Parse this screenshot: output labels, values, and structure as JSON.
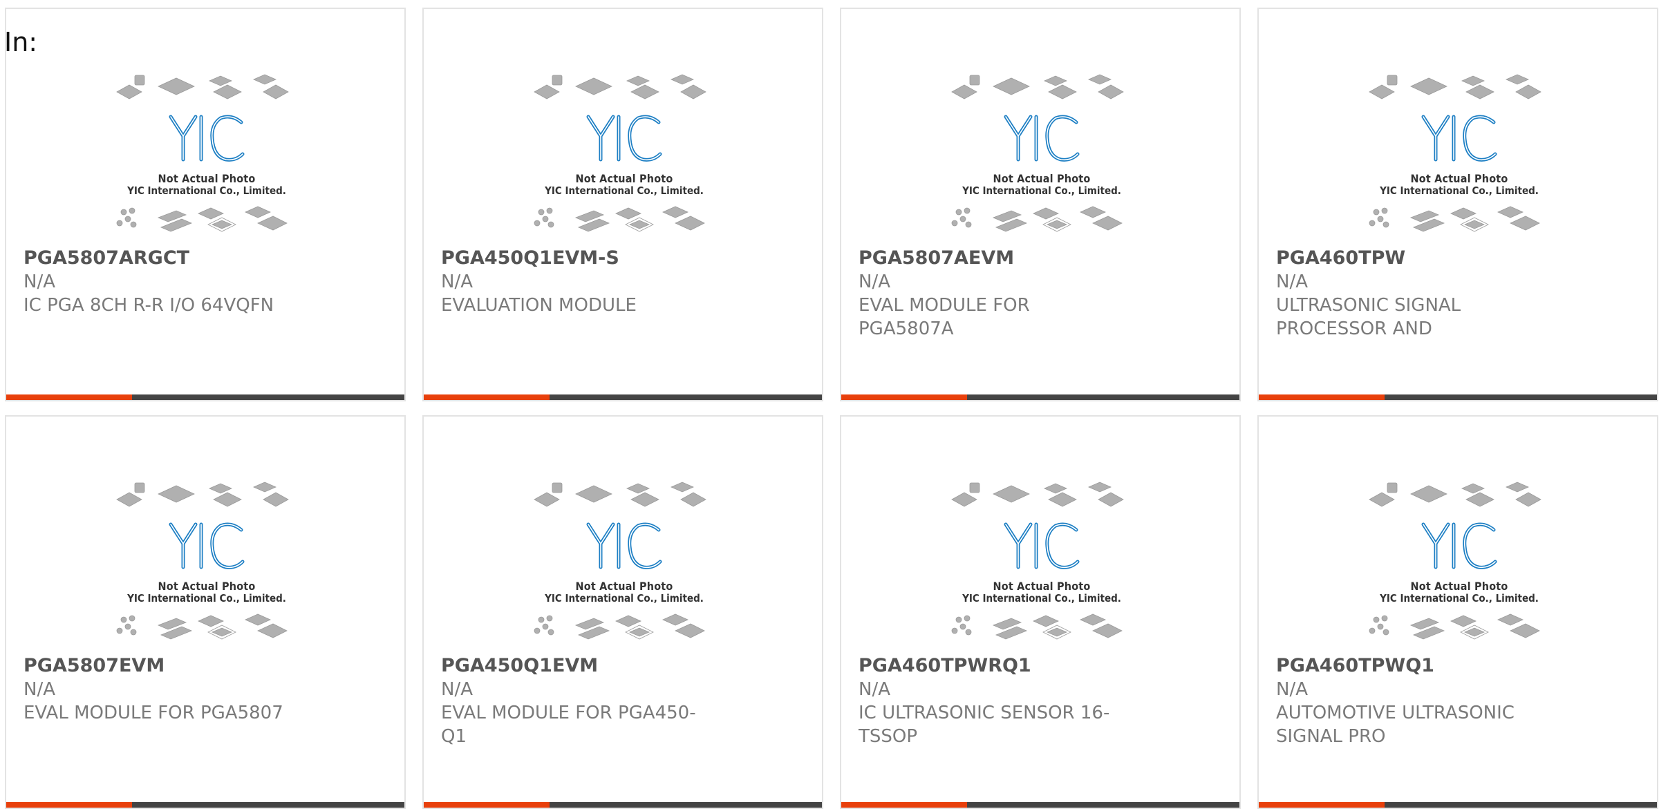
{
  "header": {
    "label": "In:"
  },
  "photo": {
    "brand": "YIC",
    "caption_line1": "Not Actual Photo",
    "caption_line2": "YIC International Co., Limited."
  },
  "colors": {
    "accent_bar": "#e8400c",
    "dark_bar": "#444444",
    "logo_blue": "#1d7fc4",
    "chip_gray": "#b0b0b0"
  },
  "products": [
    {
      "part": "PGA5807ARGCT",
      "mfr": "N/A",
      "desc": "IC PGA 8CH R-R I/O 64VQFN"
    },
    {
      "part": "PGA450Q1EVM-S",
      "mfr": "N/A",
      "desc": "EVALUATION MODULE"
    },
    {
      "part": "PGA5807AEVM",
      "mfr": "N/A",
      "desc": "EVAL MODULE FOR PGA5807A"
    },
    {
      "part": "PGA460TPW",
      "mfr": "N/A",
      "desc": "ULTRASONIC SIGNAL PROCESSOR AND"
    },
    {
      "part": "PGA5807EVM",
      "mfr": "N/A",
      "desc": "EVAL MODULE FOR PGA5807"
    },
    {
      "part": "PGA450Q1EVM",
      "mfr": "N/A",
      "desc": "EVAL MODULE FOR PGA450-Q1"
    },
    {
      "part": "PGA460TPWRQ1",
      "mfr": "N/A",
      "desc": "IC ULTRASONIC SENSOR 16-TSSOP"
    },
    {
      "part": "PGA460TPWQ1",
      "mfr": "N/A",
      "desc": "AUTOMOTIVE ULTRASONIC SIGNAL PRO"
    }
  ]
}
